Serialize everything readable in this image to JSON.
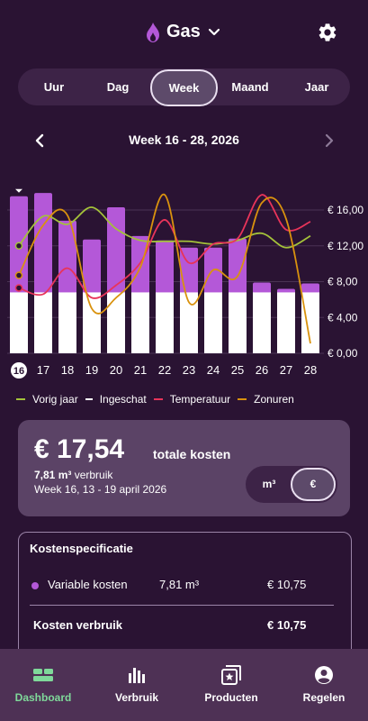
{
  "header": {
    "title": "Gas"
  },
  "tabs": [
    "Uur",
    "Dag",
    "Week",
    "Maand",
    "Jaar"
  ],
  "active_tab": "Week",
  "week_label": "Week 16 - 28, 2026",
  "colors": {
    "bar": "#b458d8",
    "bar_base": "#ffffff",
    "vorig_jaar": "#a4c23a",
    "ingeschat": "#ffffff",
    "temperatuur": "#e8345a",
    "zonuren": "#d9920e",
    "accent_green": "#7fd99a"
  },
  "chart_data": {
    "type": "bar",
    "categories": [
      "16",
      "17",
      "18",
      "19",
      "20",
      "21",
      "22",
      "23",
      "24",
      "25",
      "26",
      "27",
      "28"
    ],
    "selected_category": "16",
    "ylim": [
      0,
      16
    ],
    "y_ticks": [
      "€ 0,00",
      "€ 4,00",
      "€ 8,00",
      "€ 12,00",
      "€ 16,00"
    ],
    "series": [
      {
        "name": "Variable kosten",
        "values": [
          17.54,
          17.9,
          14.8,
          12.7,
          16.3,
          13.1,
          12.6,
          11.8,
          11.8,
          12.8,
          7.9,
          7.2,
          7.8
        ]
      },
      {
        "name": "Vorig jaar",
        "values": [
          12.0,
          15.3,
          14.4,
          16.3,
          13.9,
          12.6,
          12.5,
          12.5,
          12.2,
          12.6,
          13.4,
          11.8,
          13.1
        ]
      },
      {
        "name": "Temperatuur",
        "values": [
          7.3,
          6.6,
          9.5,
          6.2,
          7.6,
          10.1,
          14.9,
          10.1,
          12.2,
          12.8,
          17.7,
          13.8,
          14.7
        ]
      },
      {
        "name": "Zonuren",
        "values": [
          8.7,
          14.3,
          15.4,
          5.0,
          6.2,
          9.6,
          17.7,
          5.7,
          9.3,
          8.6,
          16.8,
          15.0,
          1.1
        ]
      }
    ]
  },
  "legend": [
    {
      "label": "Vorig jaar",
      "swatch": "line",
      "color": "#a4c23a"
    },
    {
      "label": "Ingeschat",
      "swatch": "dash",
      "color": "#ffffff"
    },
    {
      "label": "Temperatuur",
      "swatch": "line",
      "color": "#e8345a"
    },
    {
      "label": "Zonuren",
      "swatch": "line",
      "color": "#d9920e"
    }
  ],
  "summary": {
    "amount": "€ 17,54",
    "amount_label": "totale kosten",
    "usage_value": "7,81 m³",
    "usage_label": "verbruik",
    "period": "Week 16, 13 - 19 april 2026",
    "unit_options": [
      "m³",
      "€"
    ],
    "active_unit": "€"
  },
  "spec": {
    "title": "Kostenspecificatie",
    "rows": [
      {
        "label": "Variable kosten",
        "usage": "7,81 m³",
        "amount": "€ 10,75"
      }
    ],
    "total_label": "Kosten verbruik",
    "total_amount": "€ 10,75"
  },
  "bottom_nav": [
    {
      "label": "Dashboard",
      "icon": "dashboard-icon",
      "active": true
    },
    {
      "label": "Verbruik",
      "icon": "bar-chart-icon",
      "active": false
    },
    {
      "label": "Producten",
      "icon": "products-icon",
      "active": false
    },
    {
      "label": "Regelen",
      "icon": "account-icon",
      "active": false
    }
  ]
}
